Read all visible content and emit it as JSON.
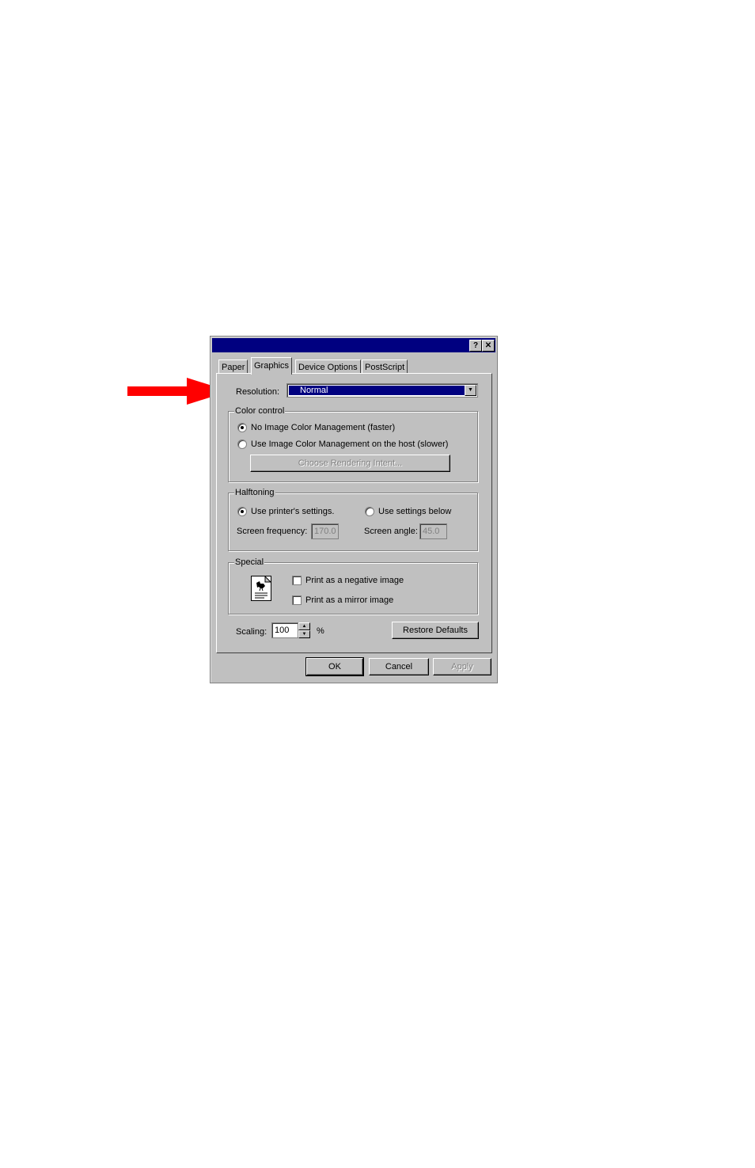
{
  "dialog": {
    "title": "",
    "help_button": "?",
    "close_button": "✕"
  },
  "tabs": [
    {
      "label": "Paper"
    },
    {
      "label": "Graphics"
    },
    {
      "label": "Device Options"
    },
    {
      "label": "PostScript"
    }
  ],
  "resolution": {
    "label": "Resolution:",
    "value": "Normal"
  },
  "color_control": {
    "legend": "Color control",
    "options": [
      {
        "label": "No Image Color Management (faster)",
        "selected": true
      },
      {
        "label": "Use Image Color Management on the host (slower)",
        "selected": false
      }
    ],
    "rendering_intent_button": "Choose Rendering Intent..."
  },
  "halftoning": {
    "legend": "Halftoning",
    "options": [
      {
        "label": "Use printer's settings.",
        "selected": true
      },
      {
        "label": "Use settings below",
        "selected": false
      }
    ],
    "frequency_label": "Screen frequency:",
    "frequency_value": "170.0",
    "angle_label": "Screen angle:",
    "angle_value": "45.0"
  },
  "special": {
    "legend": "Special",
    "options": [
      {
        "label": "Print as a negative image",
        "checked": false
      },
      {
        "label": "Print as a mirror image",
        "checked": false
      }
    ]
  },
  "scaling": {
    "label": "Scaling:",
    "value": "100",
    "unit": "%"
  },
  "buttons": {
    "restore": "Restore Defaults",
    "ok": "OK",
    "cancel": "Cancel",
    "apply": "Apply"
  },
  "colors": {
    "arrow": "#ff0000",
    "titlebar": "#000080",
    "face": "#c0c0c0"
  }
}
